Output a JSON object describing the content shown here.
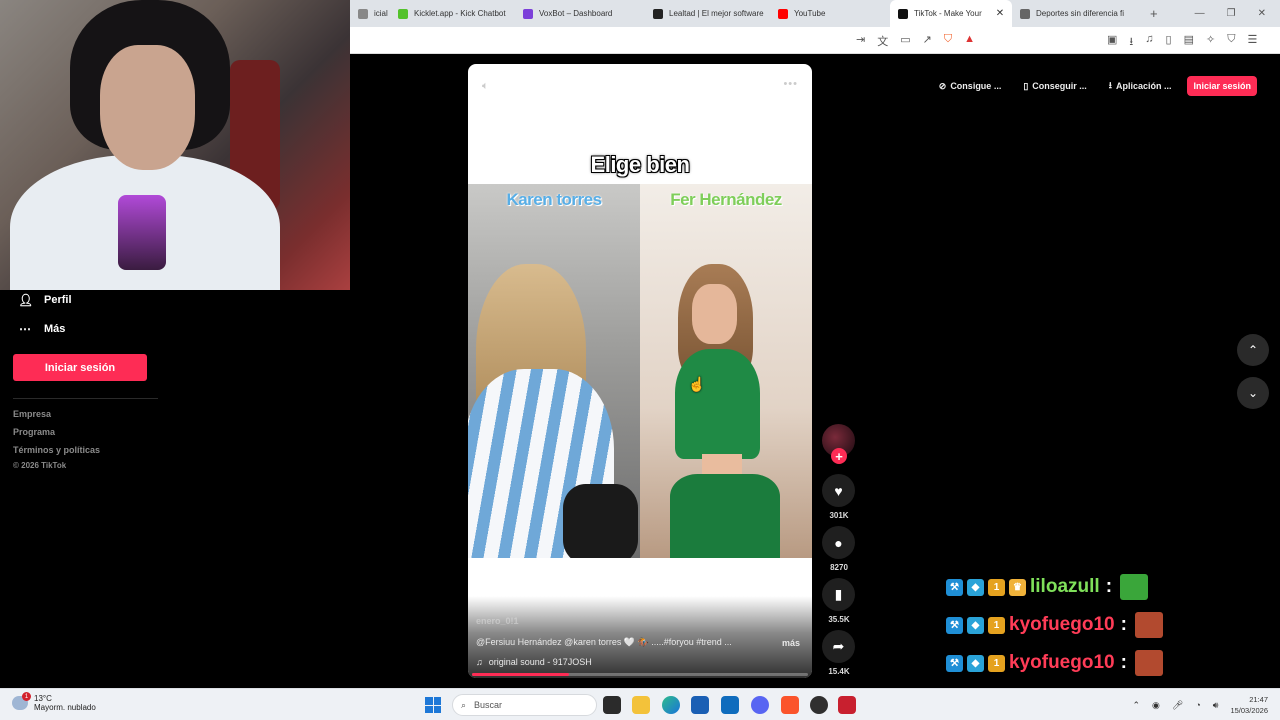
{
  "browser": {
    "tabs": [
      {
        "label": "icial I",
        "icon": "generic-page-icon",
        "color": "#888888",
        "active": false
      },
      {
        "label": "Kicklet.app - Kick Chatbot",
        "icon": "kicklet-icon",
        "color": "#53c22b",
        "active": false
      },
      {
        "label": "VoxBot – Dashboard",
        "icon": "voxbot-icon",
        "color": "#7b3fd9",
        "active": false
      },
      {
        "label": "Lealtad | El mejor software",
        "icon": "lealtad-icon",
        "color": "#222222",
        "active": false
      },
      {
        "label": "YouTube",
        "icon": "youtube-icon",
        "color": "#ff0000",
        "active": false
      },
      {
        "label": "TikTok - Make Your",
        "icon": "tiktok-icon",
        "color": "#111111",
        "active": true
      },
      {
        "label": "Deportes sin diferencia fi",
        "icon": "globe-icon",
        "color": "#666666",
        "active": false
      }
    ],
    "new_tab": "+",
    "close_tab": "✕",
    "window_controls": [
      "—",
      "❐",
      "✕"
    ]
  },
  "sidebar": {
    "items": [
      {
        "label": "Perfil",
        "icon": "person-icon"
      },
      {
        "label": "Más",
        "icon": "more-dots-icon"
      }
    ],
    "login_label": "Iniciar sesión",
    "footer": [
      "Empresa",
      "Programa",
      "Términos y políticas",
      "© 2026 TikTok"
    ]
  },
  "top_buttons": [
    {
      "label": "Consigue ...",
      "icon": "coin-icon"
    },
    {
      "label": "Conseguir ...",
      "icon": "phone-icon"
    },
    {
      "label": "Aplicación ...",
      "icon": "download-icon"
    }
  ],
  "top_login": "Iniciar sesión",
  "video": {
    "overlay_title": "Elige bien",
    "left_name": "Karen torres",
    "right_name": "Fer Hernández",
    "author": "enero_0!1",
    "description": "@Fersiuu Hernández @karen torres 🤍 🏇 .....#foryou #trend ...",
    "more": "más",
    "sound": "original sound - 917JOSH",
    "progress_fraction": 0.29
  },
  "actions": [
    {
      "name": "like",
      "icon": "heart-icon",
      "glyph": "♥",
      "count": "301K"
    },
    {
      "name": "comment",
      "icon": "comment-icon",
      "glyph": "●",
      "count": "8270"
    },
    {
      "name": "save",
      "icon": "bookmark-icon",
      "glyph": "▮",
      "count": "35.5K"
    },
    {
      "name": "share",
      "icon": "share-icon",
      "glyph": "➦",
      "count": "15.4K"
    }
  ],
  "nav": {
    "up": "⌃",
    "down": "⌄"
  },
  "chat": [
    {
      "user": "liloazull",
      "color": "green"
    },
    {
      "user": "kyofuego10",
      "color": "red"
    },
    {
      "user": "kyofuego10",
      "color": "red"
    }
  ],
  "taskbar": {
    "temperature": "13°C",
    "weather": "Mayorm. nublado",
    "weather_badge": "1",
    "search_placeholder": "Buscar",
    "time": "21:47",
    "date": "15/03/2026"
  },
  "colors": {
    "accent": "#fe2c55"
  }
}
